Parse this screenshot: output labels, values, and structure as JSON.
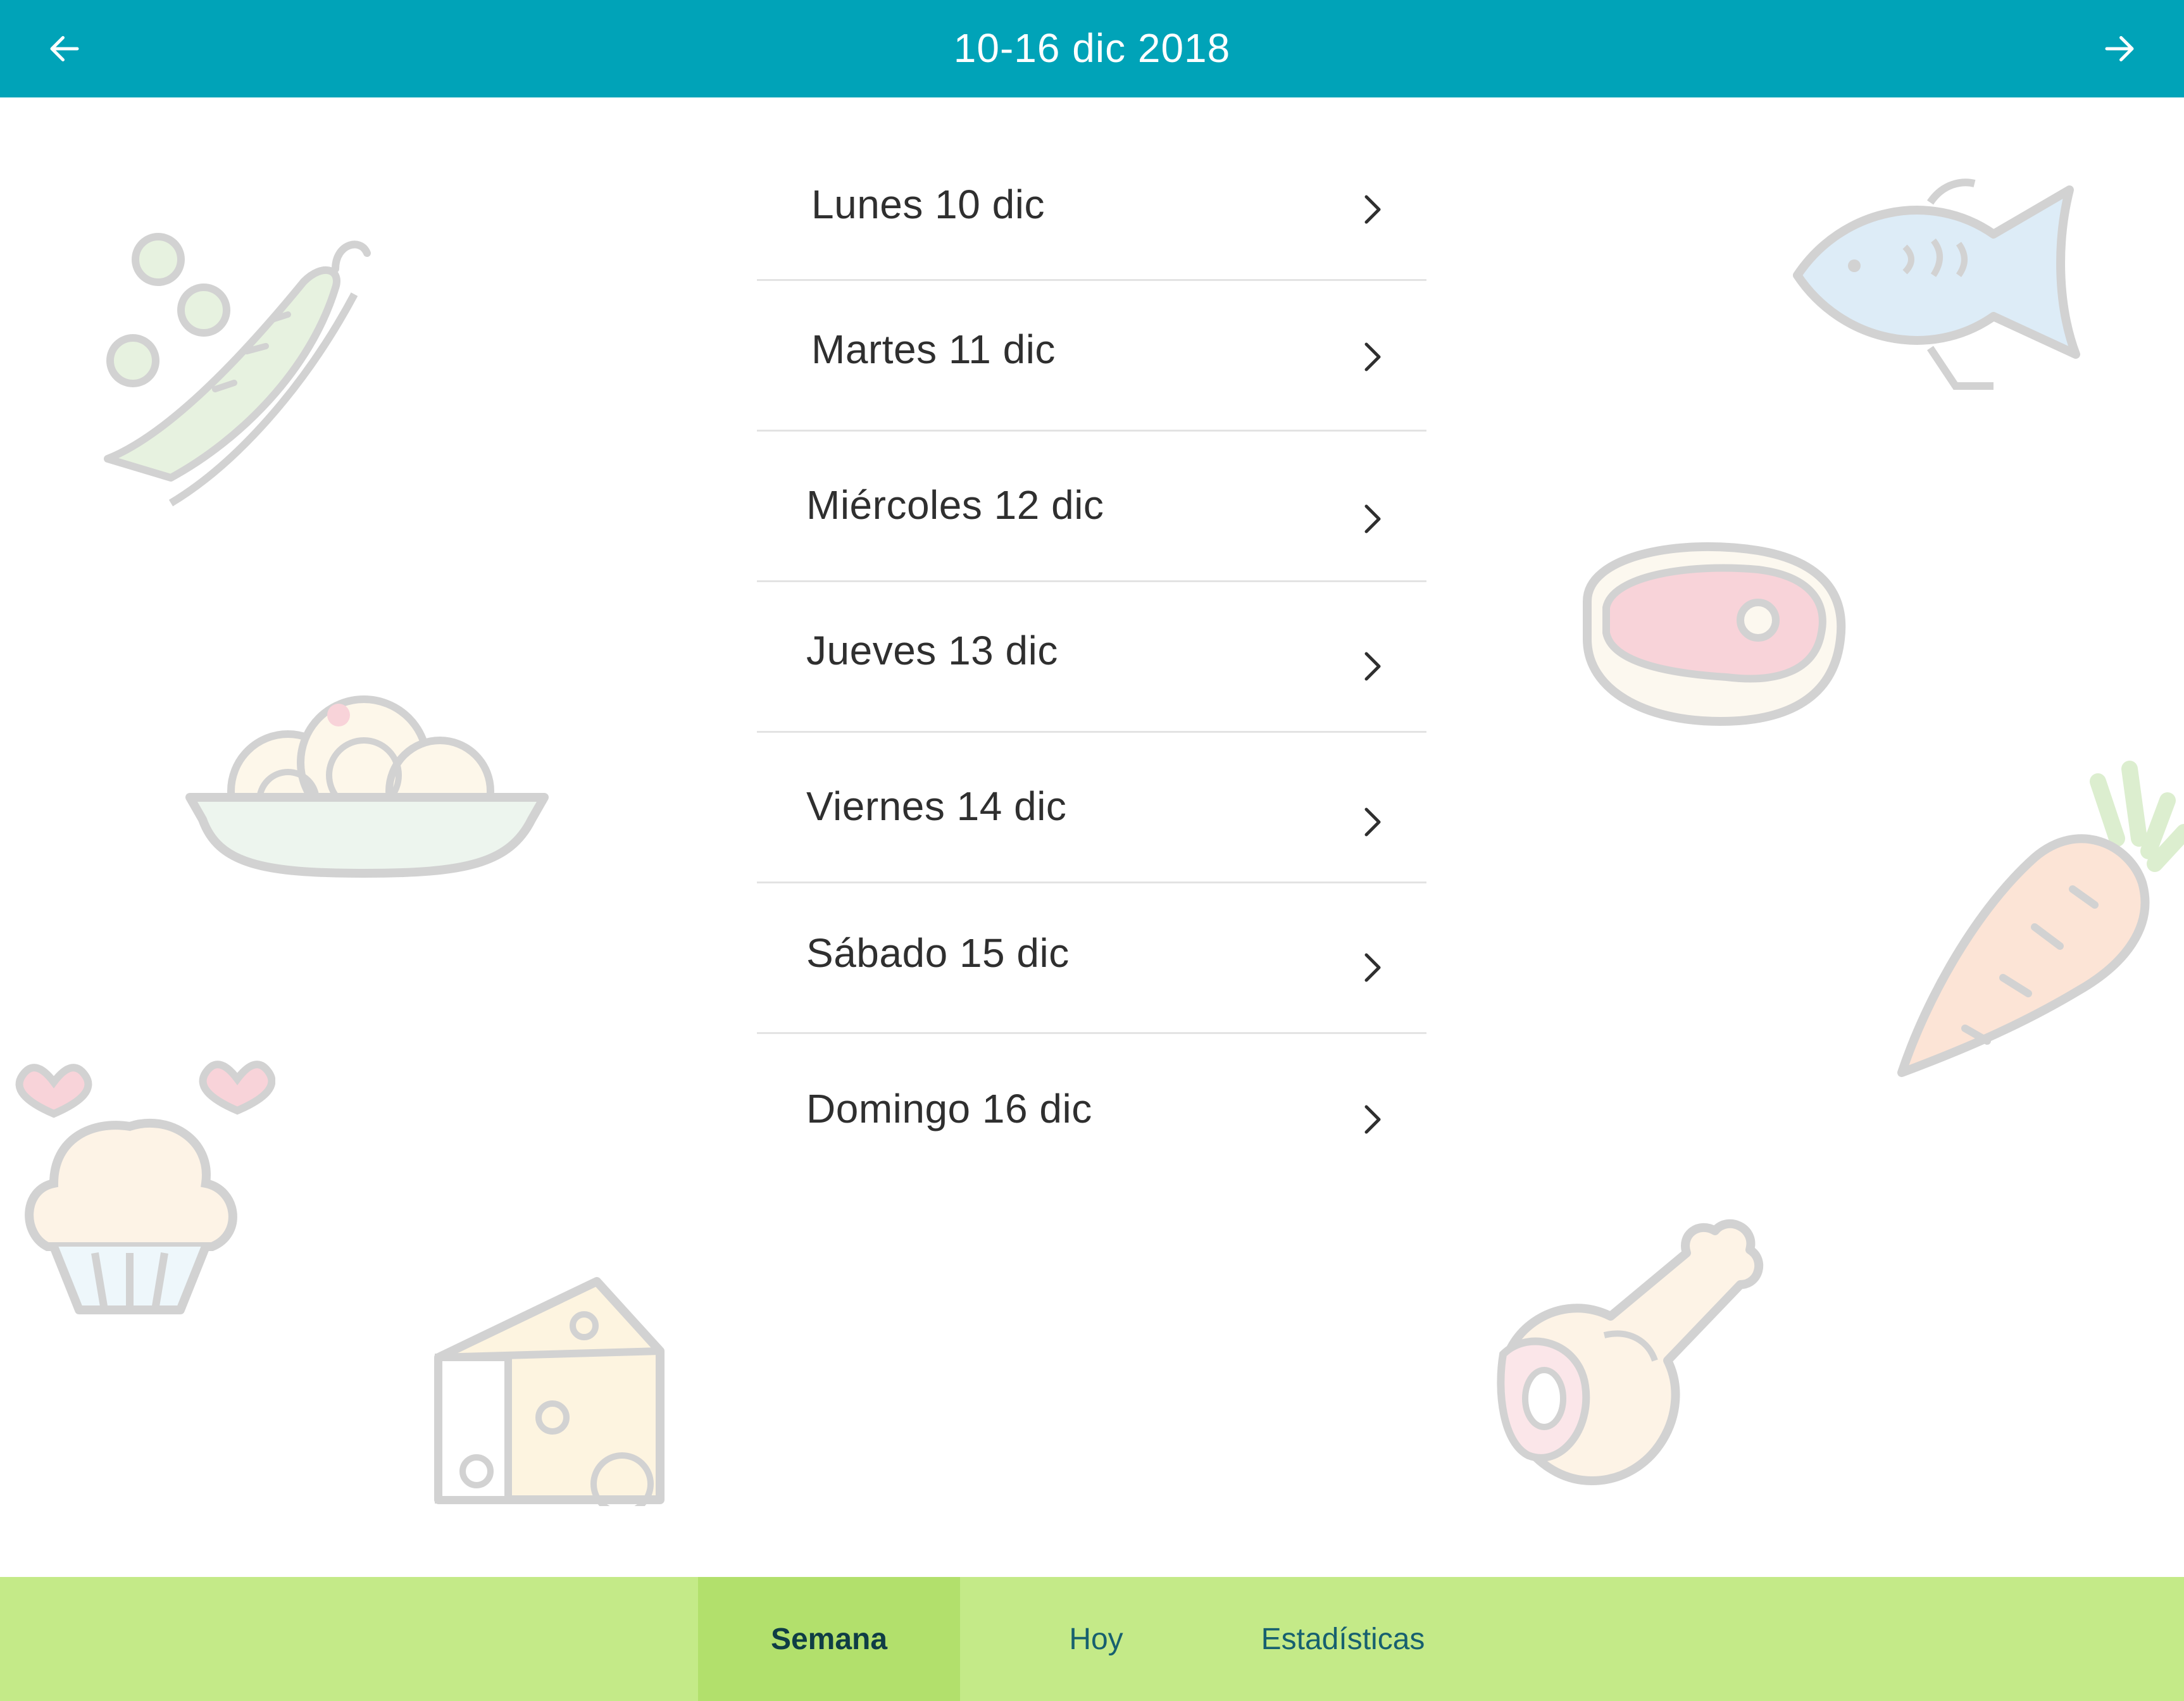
{
  "header": {
    "title": "10-16 dic 2018",
    "prev_icon": "arrow-left-icon",
    "next_icon": "arrow-right-icon",
    "background_color": "#00a3b8"
  },
  "days": [
    {
      "label": "Lunes 10 dic"
    },
    {
      "label": "Martes 11 dic"
    },
    {
      "label": "Miércoles 12 dic"
    },
    {
      "label": "Jueves 13 dic"
    },
    {
      "label": "Viernes 14 dic"
    },
    {
      "label": "Sábado 15 dic"
    },
    {
      "label": "Domingo 16 dic"
    }
  ],
  "row_chevron_icon": "chevron-right-icon",
  "bottom_nav": {
    "tabs": [
      {
        "label": "Semana",
        "active": true
      },
      {
        "label": "Hoy",
        "active": false
      },
      {
        "label": "Estadísticas",
        "active": false
      }
    ],
    "background_color": "#c4ea88",
    "active_color": "#b2e06c"
  },
  "background_illustrations": [
    "peas-icon",
    "fish-icon",
    "steak-icon",
    "pasta-bowl-icon",
    "carrot-icon",
    "cupcake-icon",
    "cheese-icon",
    "chicken-leg-icon"
  ]
}
